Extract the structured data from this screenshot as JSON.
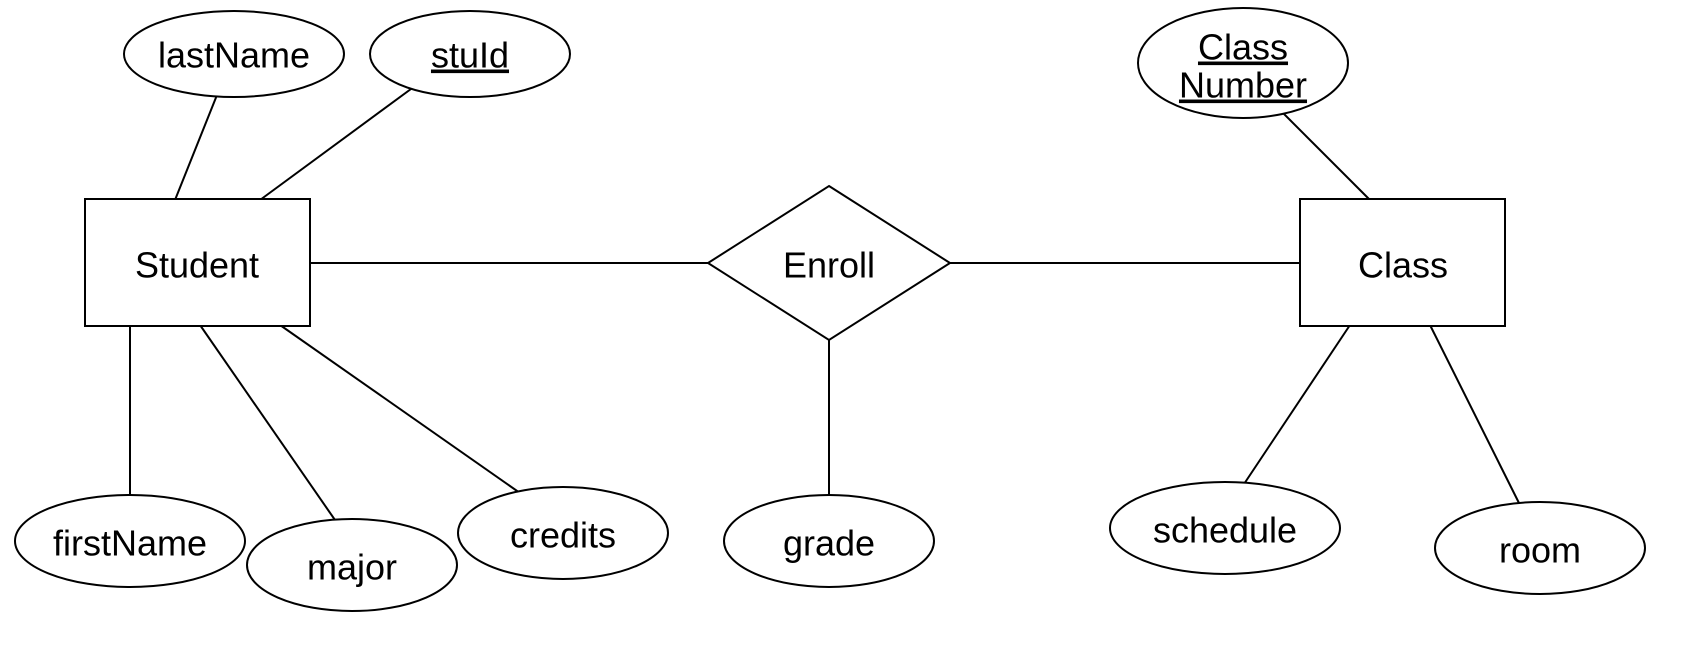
{
  "entities": {
    "student": {
      "label": "Student"
    },
    "class": {
      "label": "Class"
    }
  },
  "relationships": {
    "enroll": {
      "label": "Enroll"
    }
  },
  "attributes": {
    "lastName": {
      "label": "lastName"
    },
    "stuId": {
      "label": "stuId"
    },
    "firstName": {
      "label": "firstName"
    },
    "major": {
      "label": "major"
    },
    "credits": {
      "label": "credits"
    },
    "grade": {
      "label": "grade"
    },
    "classNumber": {
      "line1": "Class",
      "line2": "Number"
    },
    "schedule": {
      "label": "schedule"
    },
    "room": {
      "label": "room"
    }
  }
}
